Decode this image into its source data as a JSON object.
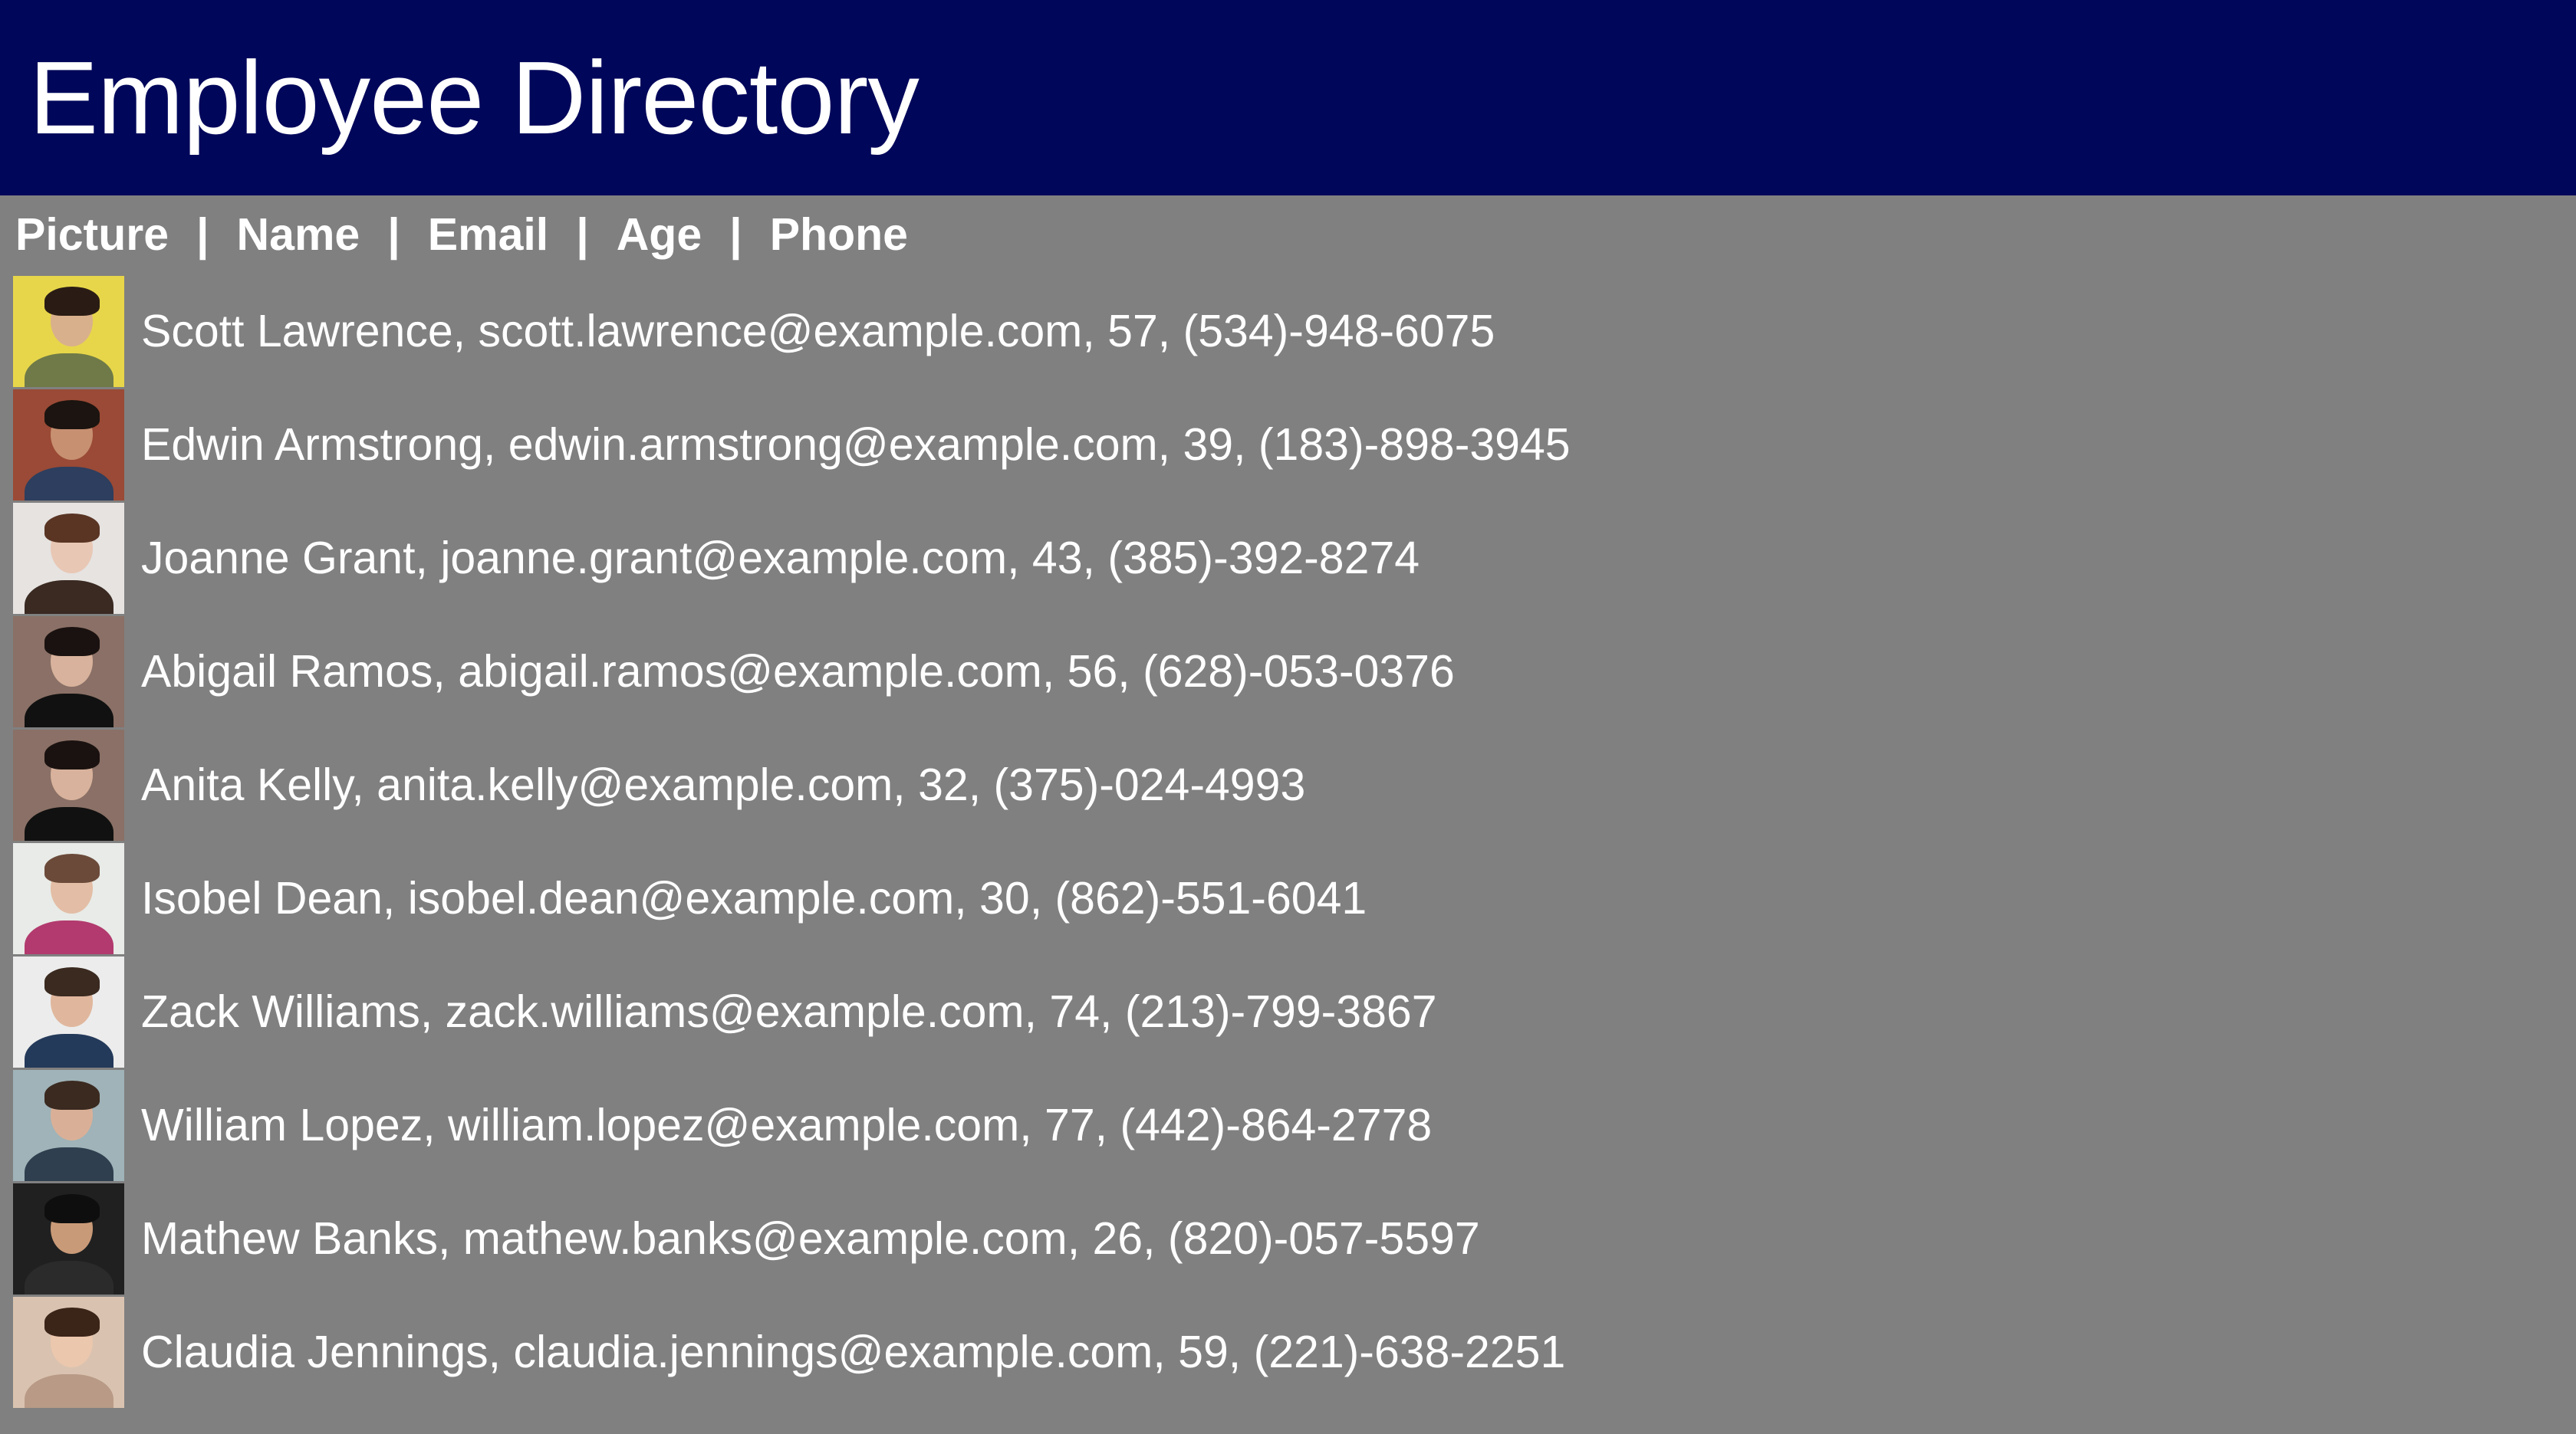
{
  "header": {
    "title": "Employee Directory"
  },
  "columns": [
    "Picture",
    "Name",
    "Email",
    "Age",
    "Phone"
  ],
  "column_separator": "|",
  "employees": [
    {
      "name": "Scott Lawrence",
      "email": "scott.lawrence@example.com",
      "age": "57",
      "phone": "(534)-948-6075",
      "avatar": {
        "bg": "#e7d64a",
        "skin": "#d9b08c",
        "hair": "#2a1c14",
        "shirt": "#6f7a48"
      }
    },
    {
      "name": "Edwin Armstrong",
      "email": "edwin.armstrong@example.com",
      "age": "39",
      "phone": "(183)-898-3945",
      "avatar": {
        "bg": "#9a4a36",
        "skin": "#c79071",
        "hair": "#1b1410",
        "shirt": "#2d3e5e"
      }
    },
    {
      "name": "Joanne Grant",
      "email": "joanne.grant@example.com",
      "age": "43",
      "phone": "(385)-392-8274",
      "avatar": {
        "bg": "#e6e3e1",
        "skin": "#e8c7b4",
        "hair": "#5a3524",
        "shirt": "#3a2a22"
      }
    },
    {
      "name": "Abigail Ramos",
      "email": "abigail.ramos@example.com",
      "age": "56",
      "phone": "(628)-053-0376",
      "avatar": {
        "bg": "#8a7066",
        "skin": "#d8b29c",
        "hair": "#1a1210",
        "shirt": "#111111"
      }
    },
    {
      "name": "Anita Kelly",
      "email": "anita.kelly@example.com",
      "age": "32",
      "phone": "(375)-024-4993",
      "avatar": {
        "bg": "#8a7066",
        "skin": "#d8b29c",
        "hair": "#1a1210",
        "shirt": "#111111"
      }
    },
    {
      "name": "Isobel Dean",
      "email": "isobel.dean@example.com",
      "age": "30",
      "phone": "(862)-551-6041",
      "avatar": {
        "bg": "#e8ebe7",
        "skin": "#e3bda5",
        "hair": "#6b4a3a",
        "shirt": "#b23a6e"
      }
    },
    {
      "name": "Zack Williams",
      "email": "zack.williams@example.com",
      "age": "74",
      "phone": "(213)-799-3867",
      "avatar": {
        "bg": "#ececec",
        "skin": "#e0b79d",
        "hair": "#3a2a20",
        "shirt": "#243a5a"
      }
    },
    {
      "name": "William Lopez",
      "email": "william.lopez@example.com",
      "age": "77",
      "phone": "(442)-864-2778",
      "avatar": {
        "bg": "#9fb3b8",
        "skin": "#d9b097",
        "hair": "#3b2a20",
        "shirt": "#2f3f4f"
      }
    },
    {
      "name": "Mathew Banks",
      "email": "mathew.banks@example.com",
      "age": "26",
      "phone": "(820)-057-5597",
      "avatar": {
        "bg": "#202020",
        "skin": "#c99a78",
        "hair": "#0e0e0e",
        "shirt": "#2b2b2b"
      }
    },
    {
      "name": "Claudia Jennings",
      "email": "claudia.jennings@example.com",
      "age": "59",
      "phone": "(221)-638-2251",
      "avatar": {
        "bg": "#d9c3b0",
        "skin": "#ebc7ad",
        "hair": "#3b2418",
        "shirt": "#b89a86"
      }
    }
  ]
}
